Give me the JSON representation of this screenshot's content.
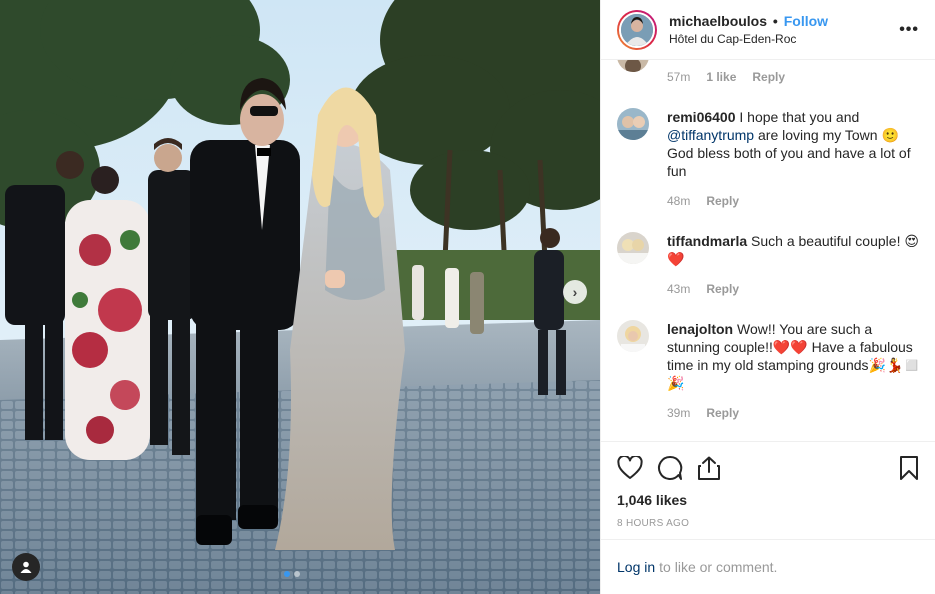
{
  "header": {
    "username": "michaelboulos",
    "separator": "•",
    "follow_label": "Follow",
    "location": "Hôtel du Cap-Eden-Roc",
    "more_label": "•••"
  },
  "photo": {
    "next_label": "›",
    "carousel_count": 2,
    "carousel_active": 1
  },
  "comments": {
    "partial": {
      "time": "57m",
      "likes": "1 like",
      "reply": "Reply"
    },
    "items": [
      {
        "username": "remi06400",
        "text_before": " I hope that you and ",
        "mention": "@tiffanytrump",
        "text_after": " are loving my Town 🙂 God bless both of you and have a lot of fun",
        "time": "48m",
        "reply": "Reply"
      },
      {
        "username": "tiffandmarla",
        "text": " Such a beautiful couple! 😍❤️",
        "time": "43m",
        "reply": "Reply"
      },
      {
        "username": "lenajolton",
        "text": " Wow!! You are such a stunning couple!!❤️❤️ Have a fabulous time in my old stamping grounds🎉💃◻️🎉",
        "time": "39m",
        "reply": "Reply"
      }
    ]
  },
  "actions": {
    "likes": "1,046 likes",
    "timestamp": "8 HOURS AGO"
  },
  "login": {
    "link": "Log in",
    "text": "to like or comment."
  },
  "colors": {
    "link_blue": "#3897f0",
    "mention_blue": "#003569",
    "muted": "#999999"
  }
}
